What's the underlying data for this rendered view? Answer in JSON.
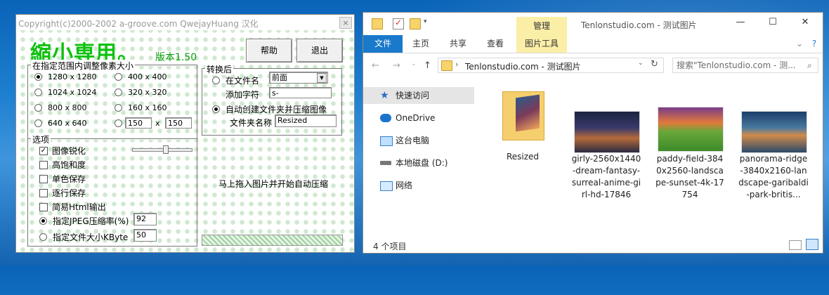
{
  "app": {
    "title": "Copyright(c)2000-2002 a-groove.com QwejayHuang 汉化",
    "close": "×",
    "logo": "縮小専用。",
    "version": "版本1.50",
    "help_btn": "帮助",
    "exit_btn": "退出",
    "size_group": "在指定范围内调整像素大小",
    "sizes": [
      "1280 x 1280",
      "400 x 400",
      "1024 x 1024",
      "320 x 320",
      "800 x 800",
      "160 x 160",
      "640 x 640"
    ],
    "custom_w": "150",
    "custom_x": "x",
    "custom_h": "150",
    "convert_group": "转换后",
    "opt_in_name": "在文件名",
    "position_select": "前面",
    "add_chars_label": "添加字符",
    "add_chars_value": "s-",
    "opt_auto_folder": "自动创建文件夹并压缩图像",
    "folder_name_label": "文件夹名称",
    "folder_name_value": "Resized",
    "options_group": "选项",
    "checks": [
      {
        "label": "图像锐化",
        "checked": true
      },
      {
        "label": "高饱和度",
        "checked": false
      },
      {
        "label": "单色保存",
        "checked": false
      },
      {
        "label": "逐行保存",
        "checked": false
      },
      {
        "label": "简易Html输出",
        "checked": false
      }
    ],
    "jpeg_label": "指定JPEG压缩率(%)",
    "jpeg_value": "92",
    "kbyte_label": "指定文件大小KByte",
    "kbyte_value": "50",
    "drop_hint": "马上拖入图片并开始自动压缩"
  },
  "explorer": {
    "ctx_tab": "管理",
    "title": "Tenlonstudio.com - 测试图片",
    "min": "—",
    "max": "☐",
    "close": "✕",
    "tabs": [
      "文件",
      "主页",
      "共享",
      "查看",
      "图片工具"
    ],
    "help": "?",
    "path": "Tenlonstudio.com - 测试图片",
    "search_placeholder": "搜索\"Tenlonstudio.com - 测...",
    "nav": [
      "快速访问",
      "OneDrive",
      "这台电脑",
      "本地磁盘 (D:)",
      "网络"
    ],
    "files": [
      {
        "name": "Resized"
      },
      {
        "name": "girly-2560x1440-dream-fantasy-surreal-anime-girl-hd-17846"
      },
      {
        "name": "paddy-field-3840x2560-landscape-sunset-4k-17754"
      },
      {
        "name": "panorama-ridge-3840x2160-landscape-garibaldi-park-britis..."
      }
    ],
    "status": "4 个项目"
  }
}
